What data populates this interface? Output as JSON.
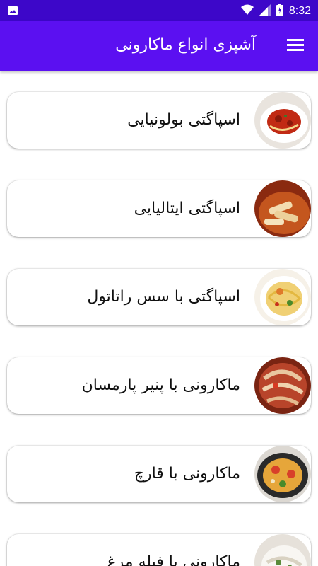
{
  "status_bar": {
    "time": "8:32",
    "icons": [
      "image-icon",
      "wifi-icon",
      "signal-icon",
      "battery-icon"
    ]
  },
  "app_bar": {
    "title": "آشپزی انواع ماکارونی",
    "menu_icon": "hamburger-menu-icon"
  },
  "colors": {
    "status_bar": "#3d07c9",
    "app_bar": "#5b10f1"
  },
  "recipes": [
    {
      "label": "اسپاگتی بولونیایی",
      "thumb": "spaghetti-bolognese-image"
    },
    {
      "label": "اسپاگتی ایتالیایی",
      "thumb": "italian-penne-image"
    },
    {
      "label": "اسپاگتی با سس راتاتول",
      "thumb": "ratatouille-spaghetti-image"
    },
    {
      "label": "ماکارونی با پنیر پارمسان",
      "thumb": "parmesan-pasta-image"
    },
    {
      "label": "ماکارونی با قارچ",
      "thumb": "mushroom-pasta-image"
    },
    {
      "label": "ماکارونی با فیله مرغ",
      "thumb": "chicken-pasta-image"
    }
  ]
}
